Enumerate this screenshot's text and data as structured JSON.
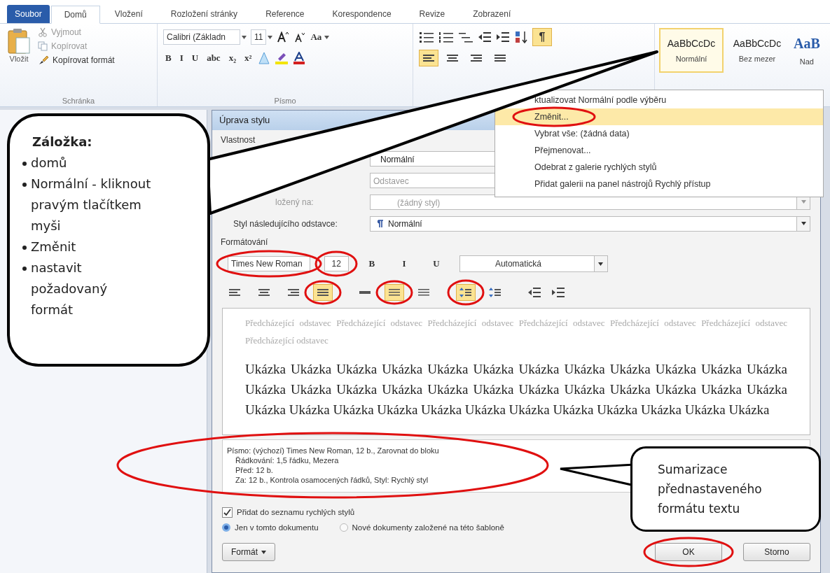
{
  "ribbon_tabs": [
    {
      "label": "Soubor",
      "kind": "file",
      "selected": false
    },
    {
      "label": "Domů",
      "kind": "tab",
      "selected": true
    },
    {
      "label": "Vložení",
      "kind": "tab",
      "selected": false
    },
    {
      "label": "Rozložení stránky",
      "kind": "tab",
      "selected": false
    },
    {
      "label": "Reference",
      "kind": "tab",
      "selected": false
    },
    {
      "label": "Korespondence",
      "kind": "tab",
      "selected": false
    },
    {
      "label": "Revize",
      "kind": "tab",
      "selected": false
    },
    {
      "label": "Zobrazení",
      "kind": "tab",
      "selected": false
    }
  ],
  "clipboard_group": {
    "paste": "Vložit",
    "cut": "Vyjmout",
    "copy": "Kopírovat",
    "format_painter": "Kopírovat formát",
    "label": "Schránka"
  },
  "font_group": {
    "font": "Calibri (Základn",
    "size": "11",
    "change_case": "Aa",
    "format_buttons": [
      "B",
      "I",
      "U",
      "abc",
      "x₂",
      "x²"
    ],
    "label": "Písmo"
  },
  "paragraph_group": {
    "show_marks": {
      "symbol": "¶",
      "selected": true
    },
    "alignment": [
      {
        "selected": true
      },
      {
        "selected": false
      },
      {
        "selected": false
      },
      {
        "selected": false
      }
    ]
  },
  "styles_gallery": [
    {
      "sample": "AaBbCcDc",
      "name": "Normální",
      "selected": true
    },
    {
      "sample": "AaBbCcDc",
      "name": "Bez mezer",
      "selected": false
    },
    {
      "sample": "AaB",
      "name": "Nad",
      "selected": false
    }
  ],
  "context_menu": [
    {
      "label": "ktualizovat Normální podle výběru",
      "selected": false
    },
    {
      "label": "Změnit...",
      "selected": true
    },
    {
      "label": "Vybrat vše: (žádná data)",
      "selected": false
    },
    {
      "label": "Přejmenovat...",
      "selected": false
    },
    {
      "label": "Odebrat z galerie rychlých stylů",
      "selected": false
    },
    {
      "label": "Přidat galerii na panel nástrojů Rychlý přístup",
      "selected": false
    }
  ],
  "dialog": {
    "title": "Úprava stylu",
    "section": "Vlastnost",
    "name_value": "Normální",
    "type_value": "Odstavec",
    "based_on": {
      "label": "ložený na:",
      "value": "(žádný styl)",
      "disabled": true
    },
    "next_style": {
      "label": "Styl následujícího odstavce:",
      "value": "Normální"
    },
    "formatting_label": "Formátování",
    "font": "Times New Roman",
    "size": "12",
    "format_buttons": [
      "B",
      "I",
      "U"
    ],
    "color_value": "Automatická",
    "alignment": [
      {
        "selected": false
      },
      {
        "selected": false
      },
      {
        "selected": false
      },
      {
        "selected": true
      }
    ],
    "line_spacing": [
      {
        "selected": false
      },
      {
        "selected": true
      },
      {
        "selected": false
      }
    ],
    "paragraph_spacing": [
      {
        "selected": true
      },
      {
        "selected": false
      }
    ],
    "preview_previous": "Předcházející odstavec Předcházející odstavec Předcházející odstavec Předcházející odstavec Předcházející odstavec Předcházející odstavec Předcházející odstavec",
    "preview_sample": "Ukázka Ukázka Ukázka Ukázka Ukázka Ukázka Ukázka Ukázka Ukázka Ukázka Ukázka Ukázka Ukázka Ukázka Ukázka Ukázka Ukázka Ukázka Ukázka Ukázka Ukázka Ukázka Ukázka Ukázka Ukázka Ukázka Ukázka Ukázka Ukázka Ukázka Ukázka Ukázka Ukázka Ukázka Ukázka Ukázka",
    "description": [
      "Písmo: (výchozí) Times New Roman, 12 b., Zarovnat do bloku",
      "Řádkování:  1,5 řádku, Mezera",
      "Před:  12 b.",
      "Za:  12 b., Kontrola osamocených řádků, Styl: Rychlý styl"
    ],
    "add_to_quick_styles": {
      "label": "Přidat do seznamu rychlých stylů",
      "checked": true
    },
    "scope": [
      {
        "label": "Jen v tomto dokumentu",
        "selected": true
      },
      {
        "label": "Nové dokumenty založené na této šabloně",
        "selected": false
      }
    ],
    "buttons": {
      "format": "Formát",
      "ok": "OK",
      "cancel": "Storno"
    }
  },
  "callout_left": {
    "title": "Záložka:",
    "items": [
      {
        "text": "domů"
      },
      {
        "text": "Normální  - kliknout pravým tlačítkem myši"
      },
      {
        "text": "Změnit"
      },
      {
        "text": "nastavit požadovaný formát"
      }
    ]
  },
  "callout_right": {
    "text": "Sumarizace přednastaveného formátu textu"
  }
}
